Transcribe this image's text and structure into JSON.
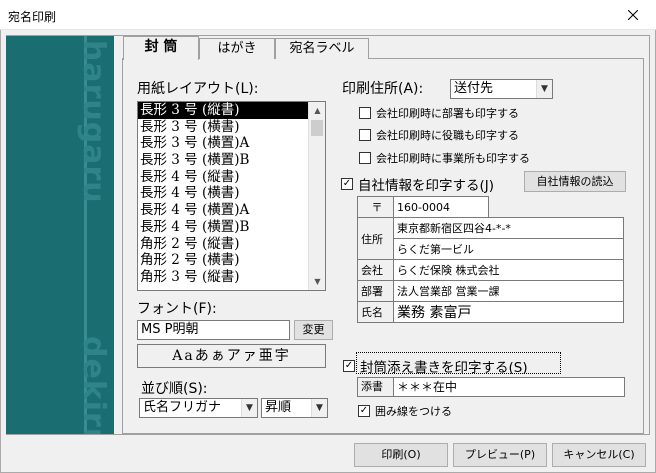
{
  "window": {
    "title": "宛名印刷",
    "close_icon": "close-icon"
  },
  "sidebar": {
    "watermark_top": "harugaru",
    "watermark_bottom": "dekiru"
  },
  "tabs": [
    {
      "label": "封 筒",
      "active": true
    },
    {
      "label": "はがき",
      "active": false
    },
    {
      "label": "宛名ラベル",
      "active": false
    }
  ],
  "layout": {
    "label": "用紙レイアウト(L):",
    "items": [
      "長形 3 号 (縦書)",
      "長形 3 号 (横書)",
      "長形 3 号 (横置)A",
      "長形 3 号 (横置)B",
      "長形 4 号 (縦書)",
      "長形 4 号 (横書)",
      "長形 4 号 (横置)A",
      "長形 4 号 (横置)B",
      "角形 2 号 (縦書)",
      "角形 2 号 (横書)",
      "角形 3 号 (縦書)"
    ],
    "selected_index": 0
  },
  "font": {
    "label": "フォント(F):",
    "value": "MS P明朝",
    "change_button": "変更",
    "sample": "Aaあぁアァ亜宇"
  },
  "sort": {
    "label": "並び順(S):",
    "field": "氏名フリガナ",
    "order": "昇順"
  },
  "print_address": {
    "label": "印刷住所(A):",
    "value": "送付先",
    "options": [
      {
        "label": "会社印刷時に部署も印字する",
        "checked": false
      },
      {
        "label": "会社印刷時に役職も印字する",
        "checked": false
      },
      {
        "label": "会社印刷時に事業所も印字する",
        "checked": false
      }
    ]
  },
  "company_info": {
    "checkbox_label": "自社情報を印字する(J)",
    "checked": true,
    "load_button": "自社情報の読込",
    "postal_symbol": "〒",
    "postal_code": "160-0004",
    "address_label": "住所",
    "address_line1": "東京都新宿区四谷4-*-*",
    "address_line2": "らくだ第一ビル",
    "company_label": "会社",
    "company": "らくだ保険 株式会社",
    "dept_label": "部署",
    "dept": "法人営業部 営業一課",
    "name_label": "氏名",
    "name": "業務 素富戸"
  },
  "envelope_note": {
    "checkbox_label": "封筒添え書きを印字する(S)",
    "checked": true,
    "note_label": "添書",
    "note_value": "＊＊＊在中",
    "frame_label": "囲み線をつける",
    "frame_checked": true
  },
  "footer": {
    "print": "印刷(O)",
    "preview": "プレビュー(P)",
    "cancel": "キャンセル(C)"
  }
}
